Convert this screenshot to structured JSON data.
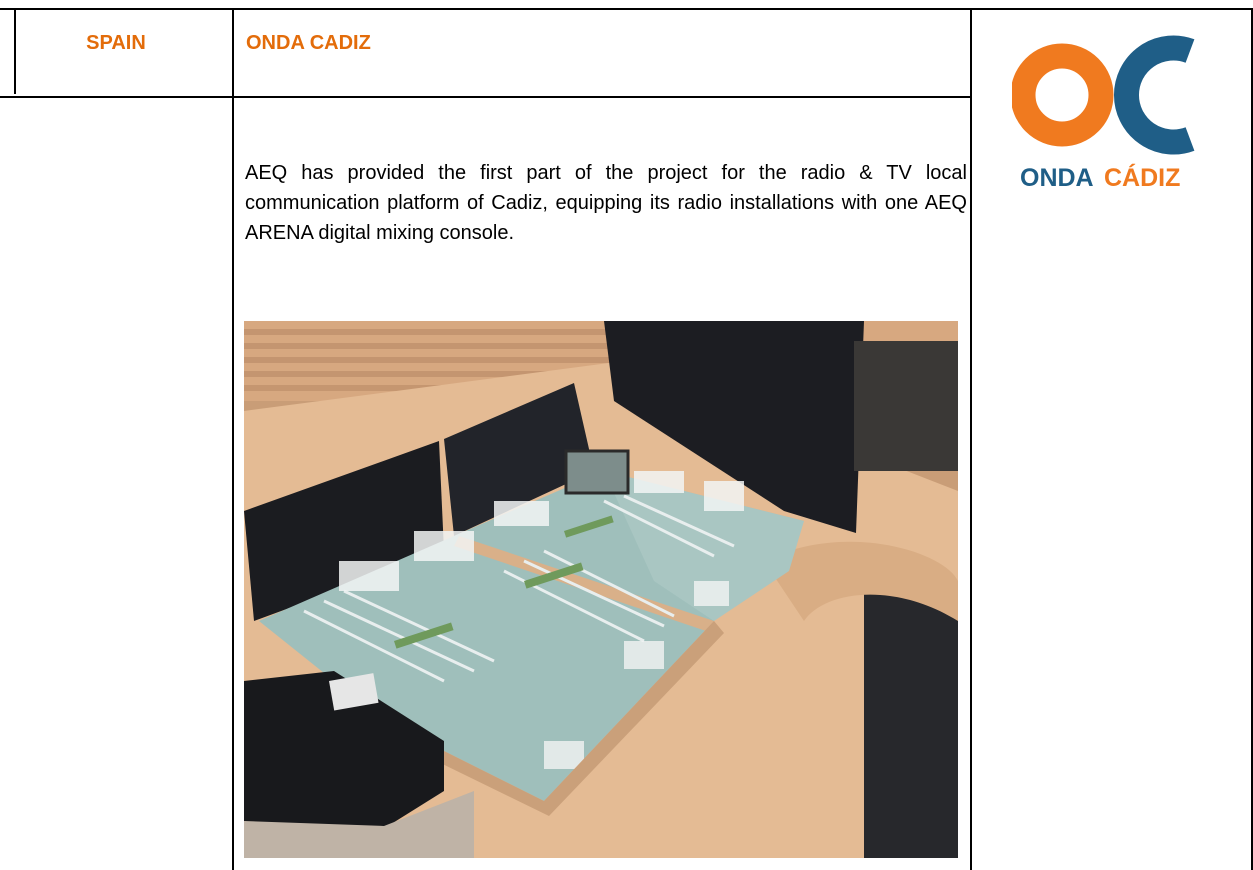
{
  "table": {
    "country": "SPAIN",
    "station": "ONDA CADIZ",
    "description": "AEQ has provided the first part of the project for the radio & TV local communication platform of Cadiz, equipping its radio installations with one AEQ ARENA digital mixing console."
  },
  "logo": {
    "monogram": "OC",
    "wordmark_part1": "ONDA",
    "wordmark_part2": "CÁDIZ",
    "colors": {
      "orange": "#f07a1f",
      "blue": "#1f5e87"
    }
  },
  "photo": {
    "subject": "AEQ ARENA digital mixing console"
  },
  "colors": {
    "heading": "#e36c0a"
  }
}
